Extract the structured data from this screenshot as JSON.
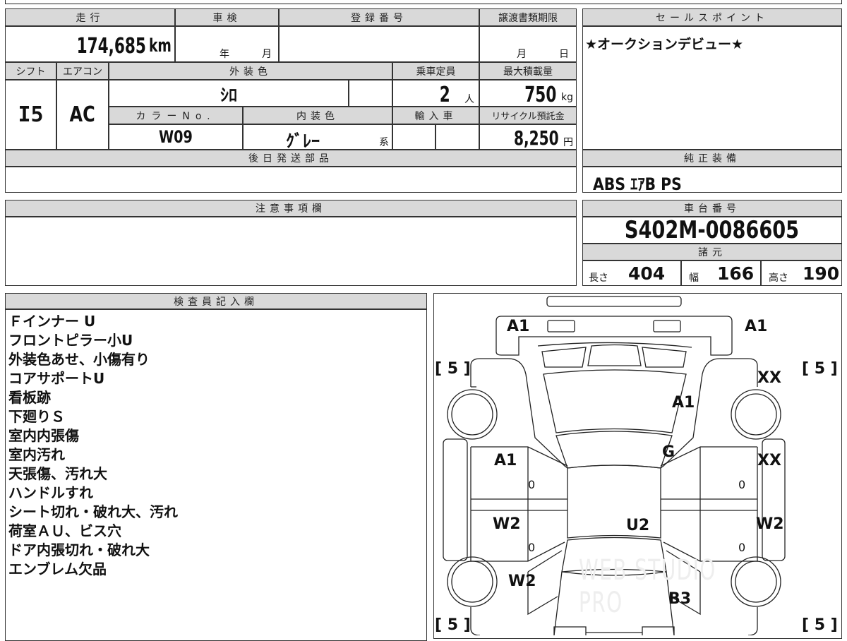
{
  "sheet": {
    "headers": {
      "mileage": "走行",
      "inspection": "車検",
      "registration": "登録番号",
      "transfer_deadline": "譲渡書類期限",
      "shift": "シフト",
      "aircon": "エアコン",
      "exterior_color": "外装色",
      "capacity": "乗車定員",
      "max_load": "最大積載量",
      "color_no": "カラーNo.",
      "interior_color": "内装色",
      "import": "輸入車",
      "recycle": "リサイクル預託金",
      "later_parts": "後日発送部品",
      "sales_point": "セールスポイント",
      "standard_equipment": "純正装備",
      "notes": "注意事項欄",
      "chassis": "車台番号",
      "specs": "諸元",
      "inspector": "検査員記入欄"
    },
    "mileage": "174,685",
    "mileage_unit": "km",
    "inspection_year": "年",
    "inspection_month": "月",
    "deadline_month": "月",
    "deadline_day": "日",
    "shift": "I5",
    "aircon": "AC",
    "exterior_color": "ｼﾛ",
    "capacity": "2",
    "capacity_unit": "人",
    "max_load": "750",
    "max_load_unit": "kg",
    "color_no": "W09",
    "interior_color": "ｸﾞﾚｰ",
    "interior_suffix": "系",
    "recycle": "8,250",
    "recycle_unit": "円",
    "sales_point": "★オークションデビュー★",
    "equipment": "ABS ｴｱB PS",
    "chassis_no": "S402M-0086605",
    "length_label": "長さ",
    "length": "404",
    "width_label": "幅",
    "width": "166",
    "height_label": "高さ",
    "height": "190",
    "inspector_notes": [
      "Ｆインナー U",
      "フロントピラー小U",
      "外装色あせ、小傷有り",
      "コアサポートU",
      "看板跡",
      "下廻りＳ",
      "室内内張傷",
      "室内汚れ",
      "天張傷、汚れ大",
      "ハンドルすれ",
      "シート切れ・破れ大、汚れ",
      "荷室ＡＵ、ビス穴",
      "ドア内張切れ・破れ大",
      "エンブレム欠品"
    ]
  },
  "diagram": {
    "labels": {
      "front_left": "A1",
      "front_right": "A1",
      "hood": "A1",
      "windshield": "G",
      "right_front_fender": "XX",
      "left_front_door": "A1",
      "right_front_door": "XX",
      "left_rear_door": "W2",
      "right_rear_door": "W2",
      "roof": "U2",
      "left_rear_fender": "W2",
      "rear": "B3",
      "door_l1": "0",
      "door_l2": "0",
      "door_r1": "0",
      "door_r2": "0"
    },
    "tires": {
      "fl": "[ 5 ]",
      "fr": "[ 5 ]",
      "rl": "[ 5 ]",
      "rr": "[ 5 ]"
    },
    "watermark": "WEB STUDIO PRO"
  }
}
